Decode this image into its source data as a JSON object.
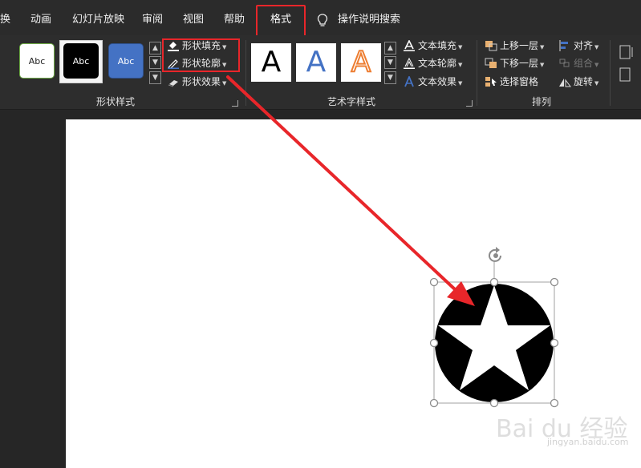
{
  "menu": {
    "tabs": [
      "换",
      "动画",
      "幻灯片放映",
      "审阅",
      "视图",
      "帮助"
    ],
    "active_tab": "格式",
    "search_label": "操作说明搜索"
  },
  "ribbon": {
    "shape_styles": {
      "label": "形状样式",
      "thumbnails": [
        "Abc",
        "Abc",
        "Abc"
      ],
      "fill": "形状填充",
      "outline": "形状轮廓",
      "effects": "形状效果"
    },
    "wordart": {
      "label": "艺术字样式",
      "samples": [
        "A",
        "A",
        "A"
      ],
      "text_fill": "文本填充",
      "text_outline": "文本轮廓",
      "text_effects": "文本效果"
    },
    "arrange": {
      "label": "排列",
      "bring_forward": "上移一层",
      "send_backward": "下移一层",
      "selection_pane": "选择窗格",
      "align": "对齐",
      "group": "组合",
      "rotate": "旋转"
    }
  },
  "watermark": {
    "brand": "Bai du 经验",
    "url": "jingyan.baidu.com"
  },
  "colors": {
    "highlight": "#e8262a",
    "ribbon_bg": "#2d2d2d",
    "slide_bg": "#ffffff",
    "accent_blue": "#4472c4",
    "accent_orange": "#ed7d31"
  }
}
